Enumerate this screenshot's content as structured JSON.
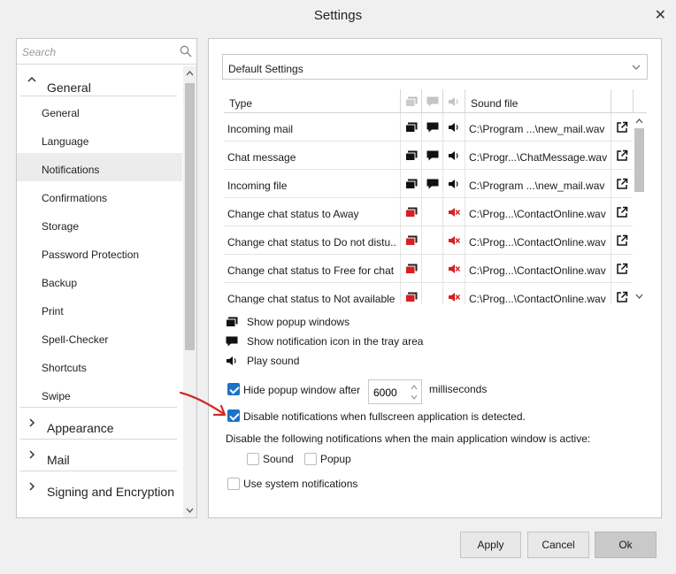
{
  "window": {
    "title": "Settings"
  },
  "sidebar": {
    "search_placeholder": "Search",
    "sections": [
      {
        "label": "General",
        "expanded": true
      },
      {
        "label": "Appearance",
        "expanded": false
      },
      {
        "label": "Mail",
        "expanded": false
      },
      {
        "label": "Signing and Encryption",
        "expanded": false
      }
    ],
    "general_items": [
      {
        "label": "General"
      },
      {
        "label": "Language"
      },
      {
        "label": "Notifications",
        "active": true
      },
      {
        "label": "Confirmations"
      },
      {
        "label": "Storage"
      },
      {
        "label": "Password Protection"
      },
      {
        "label": "Backup"
      },
      {
        "label": "Print"
      },
      {
        "label": "Spell-Checker"
      },
      {
        "label": "Shortcuts"
      },
      {
        "label": "Swipe"
      }
    ]
  },
  "main": {
    "profile_dropdown": {
      "value": "Default Settings"
    },
    "grid": {
      "headers": {
        "type": "Type",
        "sound": "Sound file"
      },
      "rows": [
        {
          "type": "Incoming mail",
          "popup": "popup-icon",
          "tray": "tray-icon",
          "sound_icon": "speaker-icon",
          "sound": "C:\\Program ...\\new_mail.wav"
        },
        {
          "type": "Chat message",
          "popup": "popup-icon",
          "tray": "tray-icon",
          "sound_icon": "speaker-icon",
          "sound": "C:\\Progr...\\ChatMessage.wav"
        },
        {
          "type": "Incoming file",
          "popup": "popup-icon",
          "tray": "tray-icon",
          "sound_icon": "speaker-icon",
          "sound": "C:\\Program ...\\new_mail.wav"
        },
        {
          "type": "Change chat status to Away",
          "popup": "popup-disabled-icon",
          "tray": "",
          "sound_icon": "speaker-disabled-icon",
          "sound": "C:\\Prog...\\ContactOnline.wav"
        },
        {
          "type": "Change chat status to Do not distu...",
          "popup": "popup-disabled-icon",
          "tray": "",
          "sound_icon": "speaker-disabled-icon",
          "sound": "C:\\Prog...\\ContactOnline.wav"
        },
        {
          "type": "Change chat status to Free for chat",
          "popup": "popup-disabled-icon",
          "tray": "",
          "sound_icon": "speaker-disabled-icon",
          "sound": "C:\\Prog...\\ContactOnline.wav"
        },
        {
          "type": "Change chat status to Not available",
          "popup": "popup-disabled-icon",
          "tray": "",
          "sound_icon": "speaker-disabled-icon",
          "sound": "C:\\Prog...\\ContactOnline.wav"
        }
      ]
    },
    "legend": {
      "popup": "Show popup windows",
      "tray": "Show notification icon in the tray area",
      "sound": "Play sound"
    },
    "options": {
      "hide_popup": {
        "label": "Hide popup window after",
        "checked": true,
        "value": "6000",
        "unit": "milliseconds"
      },
      "disable_fullscreen": {
        "label": "Disable notifications when fullscreen application is detected.",
        "checked": true
      },
      "active_window_label": "Disable the following notifications when the main application window is active:",
      "active_sound": {
        "label": "Sound",
        "checked": false
      },
      "active_popup": {
        "label": "Popup",
        "checked": false
      },
      "system_notifications": {
        "label": "Use system notifications",
        "checked": false
      }
    }
  },
  "footer": {
    "apply": "Apply",
    "cancel": "Cancel",
    "ok": "Ok"
  },
  "colors": {
    "accent": "#1a73c8",
    "disabled_red": "#d42020",
    "annotation": "#d42a2a"
  }
}
